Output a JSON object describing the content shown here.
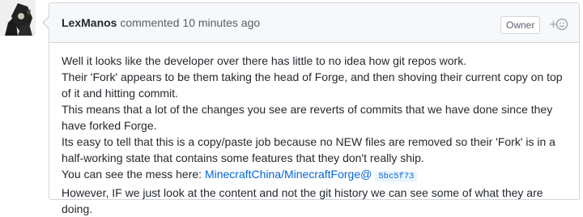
{
  "comment": {
    "author": "LexManos",
    "action_text": "commented",
    "timestamp": "10 minutes ago",
    "role_badge": "Owner",
    "reaction_icon": "smiley-plus-icon",
    "paragraphs": [
      "Well it looks like the developer over there has little to no idea how git repos work.",
      "Their 'Fork' appears to be them taking the head of Forge, and then shoving their current copy on top of it and hitting commit.",
      "This means that a lot of the changes you see are reverts of commits that we have done since they have forked Forge.",
      "Its easy to tell that this is a copy/paste job because no NEW files are removed so their 'Fork' is in a half-working state that contains some features that they don't really ship."
    ],
    "mess_prefix": "You can see the mess here:",
    "mess_link": "MinecraftChina/MinecraftForge@",
    "mess_sha": "5bc5f73",
    "closing": "However, IF we just look at the content and not the git history we can see some of what they are doing."
  }
}
